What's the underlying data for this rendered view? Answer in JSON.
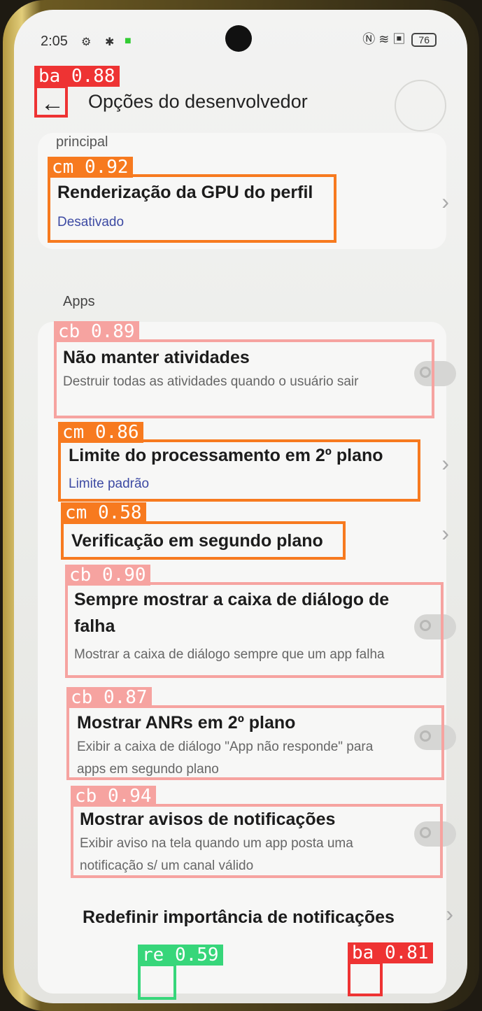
{
  "status": {
    "time": "2:05",
    "battery": "76",
    "icons": [
      "sync-icon",
      "bug-icon",
      "app-icon"
    ],
    "right_icons": [
      "nfc-icon",
      "wifi-icon",
      "sim-icon"
    ]
  },
  "appbar": {
    "title": "Opções do desenvolvedor"
  },
  "top_fragment": "principal",
  "gpu": {
    "title": "Renderização da GPU do perfil",
    "value": "Desativado"
  },
  "apps_section": "Apps",
  "items": [
    {
      "title": "Não manter atividades",
      "subtitle": "Destruir todas as atividades quando o usuário sair",
      "type": "toggle",
      "on": false
    },
    {
      "title": "Limite do processamento em 2º plano",
      "subtitle": "Limite padrão",
      "type": "nav"
    },
    {
      "title": "Verificação em segundo plano",
      "type": "nav"
    },
    {
      "title": "Sempre mostrar a caixa de diálogo de falha",
      "subtitle": "Mostrar a caixa de diálogo sempre que um app falha",
      "type": "toggle",
      "on": false
    },
    {
      "title": "Mostrar ANRs em 2º plano",
      "subtitle": "Exibir a caixa de diálogo \"App não responde\" para apps em segundo plano",
      "type": "toggle",
      "on": false
    },
    {
      "title": "Mostrar avisos de notificações",
      "subtitle": "Exibir aviso na tela quando um app posta uma notificação s/ um canal válido",
      "type": "toggle",
      "on": false
    },
    {
      "title": "Redefinir importância de notificações",
      "type": "nav"
    }
  ],
  "detections": [
    {
      "label": "ba 0.88",
      "color": "#ee3333"
    },
    {
      "label": "cm 0.92",
      "color": "#f77a1f"
    },
    {
      "label": "cb 0.89",
      "color": "#f6a3a0"
    },
    {
      "label": "cm 0.86",
      "color": "#f77a1f"
    },
    {
      "label": "cm 0.58",
      "color": "#f77a1f"
    },
    {
      "label": "cb 0.90",
      "color": "#f6a3a0"
    },
    {
      "label": "cb 0.87",
      "color": "#f6a3a0"
    },
    {
      "label": "cb 0.94",
      "color": "#f6a3a0"
    },
    {
      "label": "re 0.59",
      "color": "#37d67a"
    },
    {
      "label": "ba 0.81",
      "color": "#ee3333"
    }
  ]
}
